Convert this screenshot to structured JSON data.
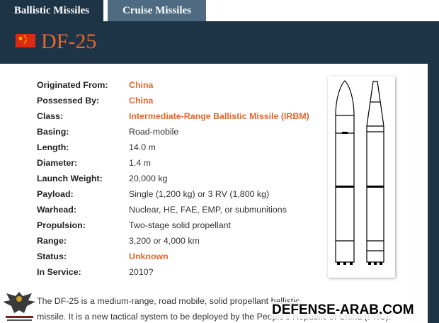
{
  "tabs": [
    {
      "label": "Ballistic Missiles",
      "active": true
    },
    {
      "label": "Cruise Missiles",
      "active": false
    }
  ],
  "header": {
    "title": "DF-25",
    "flag_icon": "china-flag-icon",
    "bg_color": "#1d3447",
    "title_color": "#e8662c"
  },
  "specs": [
    {
      "key": "Originated From:",
      "value": "China",
      "highlight": true
    },
    {
      "key": "Possessed By:",
      "value": "China",
      "highlight": true
    },
    {
      "key": "Class:",
      "value": "Intermediate-Range Ballistic Missile (IRBM)",
      "highlight": true
    },
    {
      "key": "Basing:",
      "value": "Road-mobile",
      "highlight": false
    },
    {
      "key": "Length:",
      "value": "14.0 m",
      "highlight": false
    },
    {
      "key": "Diameter:",
      "value": "1.4 m",
      "highlight": false
    },
    {
      "key": "Launch Weight:",
      "value": "20,000 kg",
      "highlight": false
    },
    {
      "key": "Payload:",
      "value": "Single (1,200 kg) or 3 RV (1,800 kg)",
      "highlight": false
    },
    {
      "key": "Warhead:",
      "value": "Nuclear, HE, FAE, EMP, or submunitions",
      "highlight": false
    },
    {
      "key": "Propulsion:",
      "value": "Two-stage solid propellant",
      "highlight": false
    },
    {
      "key": "Range:",
      "value": "3,200 or 4,000 km",
      "highlight": false
    },
    {
      "key": "Status:",
      "value": "Unknown",
      "highlight": true
    },
    {
      "key": "In Service:",
      "value": "2010?",
      "highlight": false
    }
  ],
  "description": {
    "line1": "The DF-25 is a medium-range, road mobile, solid propellant ballistic",
    "line2": "missile. It is a new tactical system to be deployed by the People's Republic of China (PRC)."
  },
  "watermark": {
    "text": "DEFENSE-ARAB.COM",
    "logo_icon": "eagle-logo-icon"
  }
}
